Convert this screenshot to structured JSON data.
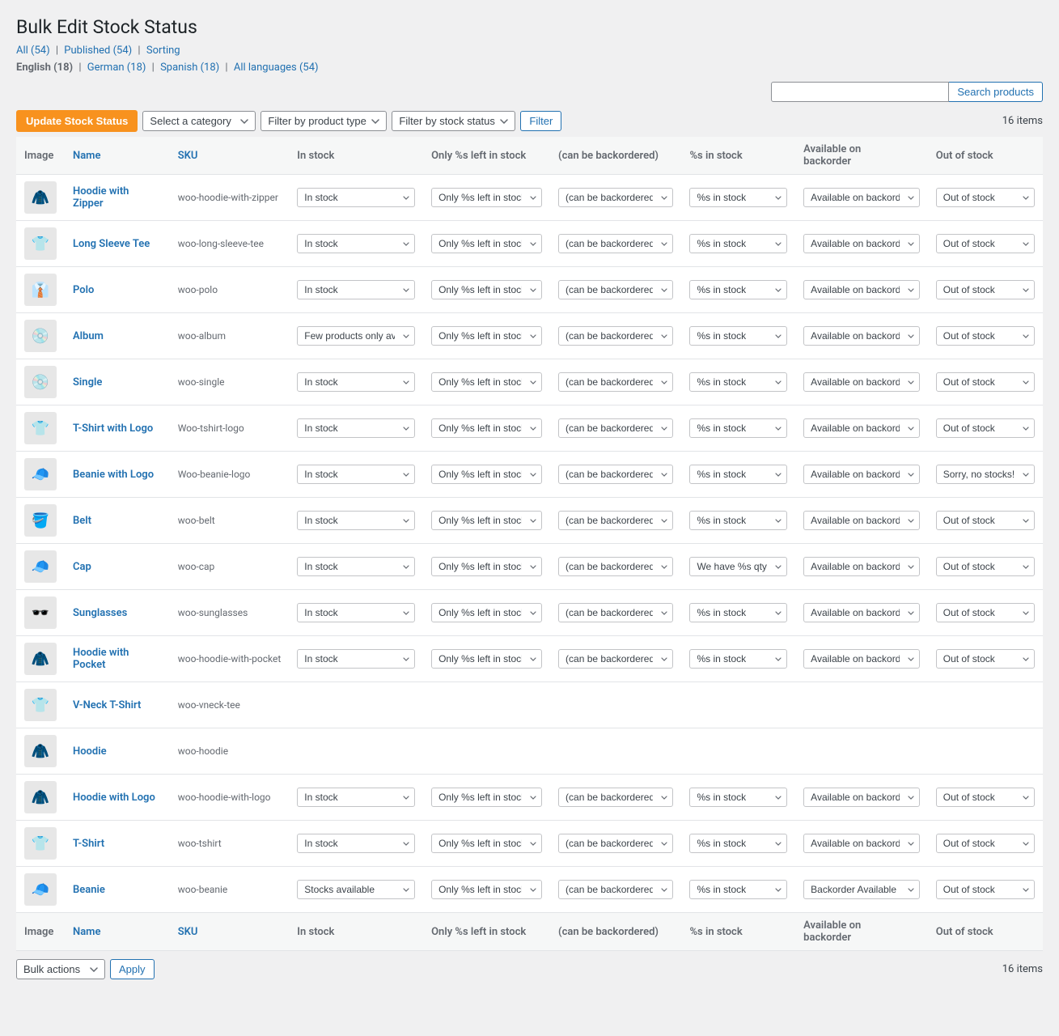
{
  "page": {
    "title": "Bulk Edit Stock Status"
  },
  "sublinks": [
    {
      "label": "All (54)",
      "key": "all"
    },
    {
      "label": "Published (54)",
      "key": "published"
    },
    {
      "label": "Sorting",
      "key": "sorting"
    }
  ],
  "lang_links": [
    {
      "label": "English (18)",
      "key": "en"
    },
    {
      "label": "German (18)",
      "key": "de"
    },
    {
      "label": "Spanish (18)",
      "key": "es"
    },
    {
      "label": "All languages (54)",
      "key": "all"
    }
  ],
  "toolbar": {
    "update_button": "Update Stock Status",
    "category_placeholder": "Select a category",
    "product_type_placeholder": "Filter by product type",
    "stock_status_placeholder": "Filter by stock status",
    "filter_button": "Filter",
    "items_count": "16 items",
    "search_placeholder": "",
    "search_button": "Search products"
  },
  "columns": {
    "image": "Image",
    "name": "Name",
    "sku": "SKU",
    "in_stock": "In stock",
    "pct_left": "Only %s left in stock",
    "backorder": "(can be backordered)",
    "pct_in_stock": "%s in stock",
    "avail_backorder": "Available on backorder",
    "out_of_stock": "Out of stock"
  },
  "products": [
    {
      "image": "🧥",
      "name": "Hoodie with Zipper",
      "sku": "woo-hoodie-with-zipper",
      "in_stock": "In stock",
      "pct_left": "Only %s left in stock",
      "backorder": "(can be backordered)",
      "pct_in_stock": "%s in stock",
      "avail_backorder": "Available on backorde",
      "out_of_stock": "Out of stock"
    },
    {
      "image": "👕",
      "name": "Long Sleeve Tee",
      "sku": "woo-long-sleeve-tee",
      "in_stock": "In stock",
      "pct_left": "Only %s left in stock",
      "backorder": "(can be backordered)",
      "pct_in_stock": "%s in stock",
      "avail_backorder": "Available on backorde",
      "out_of_stock": "Out of stock"
    },
    {
      "image": "👔",
      "name": "Polo",
      "sku": "woo-polo",
      "in_stock": "In stock",
      "pct_left": "Only %s left in stock",
      "backorder": "(can be backordered)",
      "pct_in_stock": "%s in stock",
      "avail_backorder": "Available on backorde",
      "out_of_stock": "Out of stock"
    },
    {
      "image": "💿",
      "name": "Album",
      "sku": "woo-album",
      "in_stock": "Few products only ava",
      "pct_left": "Only %s left in stock",
      "backorder": "(can be backordered)",
      "pct_in_stock": "%s in stock",
      "avail_backorder": "Available on backorde",
      "out_of_stock": "Out of stock"
    },
    {
      "image": "💿",
      "name": "Single",
      "sku": "woo-single",
      "in_stock": "In stock",
      "pct_left": "Only %s left in stock",
      "backorder": "(can be backordered)",
      "pct_in_stock": "%s in stock",
      "avail_backorder": "Available on backorde",
      "out_of_stock": "Out of stock"
    },
    {
      "image": "👕",
      "name": "T-Shirt with Logo",
      "sku": "Woo-tshirt-logo",
      "in_stock": "In stock",
      "pct_left": "Only %s left in stock",
      "backorder": "(can be backordered)",
      "pct_in_stock": "%s in stock",
      "avail_backorder": "Available on backorde",
      "out_of_stock": "Out of stock"
    },
    {
      "image": "🧢",
      "name": "Beanie with Logo",
      "sku": "Woo-beanie-logo",
      "in_stock": "In stock",
      "pct_left": "Only %s left in stock",
      "backorder": "(can be backordered)",
      "pct_in_stock": "%s in stock",
      "avail_backorder": "Available on backorde",
      "out_of_stock": "Sorry, no stocks!"
    },
    {
      "image": "🪣",
      "name": "Belt",
      "sku": "woo-belt",
      "in_stock": "In stock",
      "pct_left": "Only %s left in stock",
      "backorder": "(can be backordered)",
      "pct_in_stock": "%s in stock",
      "avail_backorder": "Available on backorde",
      "out_of_stock": "Out of stock"
    },
    {
      "image": "🧢",
      "name": "Cap",
      "sku": "woo-cap",
      "in_stock": "In stock",
      "pct_left": "Only %s left in stock",
      "backorder": "(can be backordered)",
      "pct_in_stock": "We have %s qty",
      "avail_backorder": "Available on backorde",
      "out_of_stock": "Out of stock"
    },
    {
      "image": "🕶️",
      "name": "Sunglasses",
      "sku": "woo-sunglasses",
      "in_stock": "In stock",
      "pct_left": "Only %s left in stock",
      "backorder": "(can be backordered)",
      "pct_in_stock": "%s in stock",
      "avail_backorder": "Available on backorde",
      "out_of_stock": "Out of stock"
    },
    {
      "image": "🧥",
      "name": "Hoodie with Pocket",
      "sku": "woo-hoodie-with-pocket",
      "in_stock": "In stock",
      "pct_left": "Only %s left in stock",
      "backorder": "(can be backordered)",
      "pct_in_stock": "%s in stock",
      "avail_backorder": "Available on backorde",
      "out_of_stock": "Out of stock"
    },
    {
      "image": "👕",
      "name": "V-Neck T-Shirt",
      "sku": "woo-vneck-tee",
      "in_stock": "",
      "pct_left": "",
      "backorder": "",
      "pct_in_stock": "",
      "avail_backorder": "",
      "out_of_stock": ""
    },
    {
      "image": "🧥",
      "name": "Hoodie",
      "sku": "woo-hoodie",
      "in_stock": "",
      "pct_left": "",
      "backorder": "",
      "pct_in_stock": "",
      "avail_backorder": "",
      "out_of_stock": ""
    },
    {
      "image": "🧥",
      "name": "Hoodie with Logo",
      "sku": "woo-hoodie-with-logo",
      "in_stock": "In stock",
      "pct_left": "Only %s left in stock",
      "backorder": "(can be backordered)",
      "pct_in_stock": "%s in stock",
      "avail_backorder": "Available on backorde",
      "out_of_stock": "Out of stock"
    },
    {
      "image": "👕",
      "name": "T-Shirt",
      "sku": "woo-tshirt",
      "in_stock": "In stock",
      "pct_left": "Only %s left in stock",
      "backorder": "(can be backordered)",
      "pct_in_stock": "%s in stock",
      "avail_backorder": "Available on backorde",
      "out_of_stock": "Out of stock"
    },
    {
      "image": "🧢",
      "name": "Beanie",
      "sku": "woo-beanie",
      "in_stock": "Stocks available",
      "pct_left": "Only %s left in stock",
      "backorder": "(can be backordered)",
      "pct_in_stock": "%s in stock",
      "avail_backorder": "Backorder Available",
      "out_of_stock": "Out of stock"
    }
  ],
  "footer": {
    "bulk_actions_label": "Bulk actions",
    "apply_button": "Apply",
    "items_count": "16 items"
  }
}
